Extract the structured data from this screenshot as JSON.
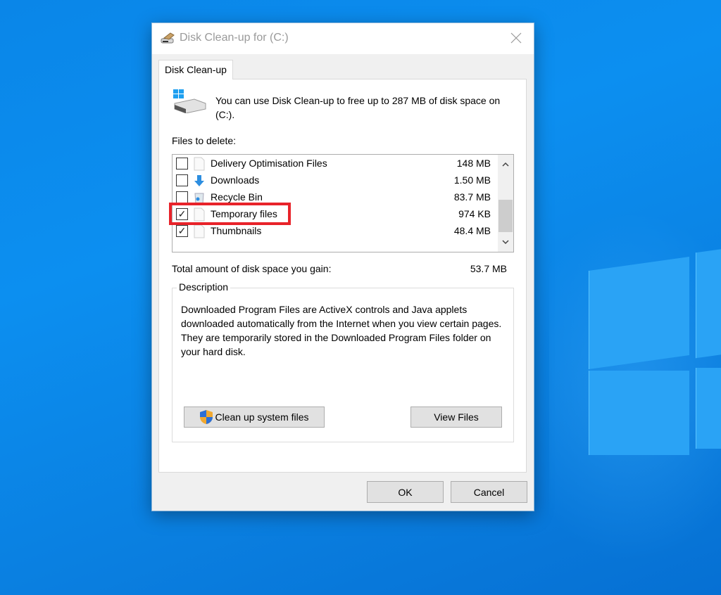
{
  "window": {
    "title": "Disk Clean-up for  (C:)",
    "close_icon": "close-icon",
    "app_icon": "disk-cleanup-icon"
  },
  "tabs": [
    {
      "label": "Disk Clean-up",
      "active": true
    }
  ],
  "intro_text": "You can use Disk Clean-up to free up to 287 MB of disk space on  (C:).",
  "files_label": "Files to delete:",
  "files": [
    {
      "name": "Delivery Optimisation Files",
      "size": "148 MB",
      "checked": false,
      "icon": "file-icon"
    },
    {
      "name": "Downloads",
      "size": "1.50 MB",
      "checked": false,
      "icon": "download-arrow-icon"
    },
    {
      "name": "Recycle Bin",
      "size": "83.7 MB",
      "checked": false,
      "icon": "recycle-bin-icon"
    },
    {
      "name": "Temporary files",
      "size": "974 KB",
      "checked": true,
      "icon": "file-icon",
      "highlighted": true
    },
    {
      "name": "Thumbnails",
      "size": "48.4 MB",
      "checked": true,
      "icon": "file-icon"
    }
  ],
  "total_label": "Total amount of disk space you gain:",
  "total_value": "53.7 MB",
  "description": {
    "title": "Description",
    "text": "Downloaded Program Files are ActiveX controls and Java applets downloaded automatically from the Internet when you view certain pages. They are temporarily stored in the Downloaded Program Files folder on your hard disk."
  },
  "buttons": {
    "cleanup_system": "Clean up system files",
    "view_files": "View Files",
    "ok": "OK",
    "cancel": "Cancel"
  },
  "check_glyph": "✓",
  "colors": {
    "highlight": "#e8232a",
    "desktop": "#0a86e8"
  }
}
